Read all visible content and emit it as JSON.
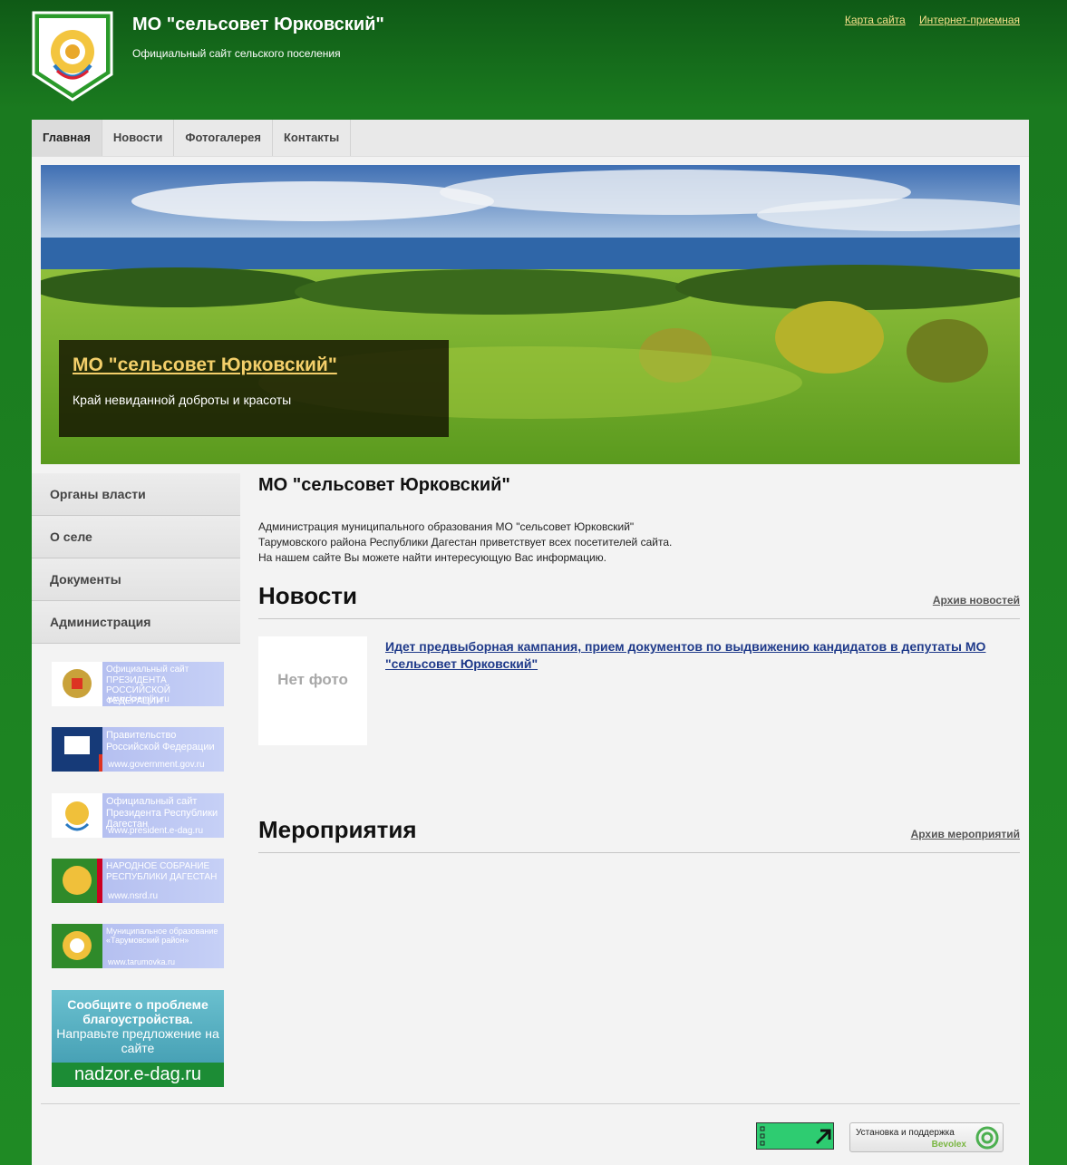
{
  "header": {
    "title": "МО \"сельсовет Юрковский\"",
    "subtitle": "Официальный сайт сельского поселения",
    "links": [
      "Карта сайта",
      "Интернет-приемная"
    ]
  },
  "nav": {
    "items": [
      "Главная",
      "Новости",
      "Фотогалерея",
      "Контакты"
    ],
    "active": "Главная"
  },
  "hero": {
    "title": "МО \"сельсовет Юрковский\"",
    "text": "Край невиданной доброты и красоты"
  },
  "sidebar": {
    "items": [
      "Органы власти",
      "О селе",
      "Документы",
      "Администрация"
    ]
  },
  "banners": [
    {
      "text": "Официальный сайт ПРЕЗИДЕНТА РОССИЙСКОЙ ФЕДЕРАЦИИ",
      "url": "www.kremlin.ru"
    },
    {
      "text": "Правительство Российской Федерации",
      "url": "www.government.gov.ru"
    },
    {
      "text": "Официальный сайт Президента Республики Дагестан",
      "url": "www.president.e-dag.ru"
    },
    {
      "text": "НАРОДНОЕ СОБРАНИЕ РЕСПУБЛИКИ ДАГЕСТАН",
      "url": "www.nsrd.ru"
    },
    {
      "text": "Муниципальное образование «Тарумовский район»",
      "url": "www.tarumovka.ru"
    }
  ],
  "nadzor": {
    "line1": "Сообщите о проблеме благоустройства.",
    "line2": "Направьте предложение на сайте",
    "url": "nadzor.e-dag.ru"
  },
  "main": {
    "title": "МО \"сельсовет Юрковский\"",
    "intro": [
      "Администрация муниципального образования МО \"сельсовет Юрковский\"",
      "Тарумовского района Республики Дагестан приветствует всех посетителей сайта.",
      "На нашем сайте Вы можете найти интересующую Вас информацию."
    ],
    "news": {
      "title": "Новости",
      "archive": "Архив новостей",
      "items": [
        {
          "no_photo": "Нет фото",
          "headline": "Идет предвыборная кампания, прием документов по выдвижению кандидатов в депутаты МО \"сельсовет Юрковский\""
        }
      ]
    },
    "events": {
      "title": "Мероприятия",
      "archive": "Архив мероприятий"
    }
  },
  "footer": {
    "support_label": "Установка и поддержка",
    "support_brand": "Bevolex"
  }
}
